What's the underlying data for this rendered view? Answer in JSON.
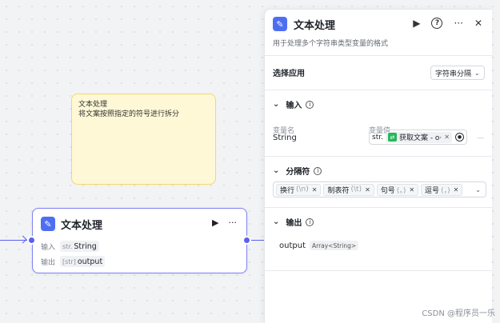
{
  "note": {
    "title": "文本处理",
    "body": "将文案按照指定的符号进行拆分"
  },
  "node": {
    "icon": "text-process-app-icon",
    "title": "文本处理",
    "run_icon": "▶",
    "more_icon": "···",
    "input_label": "输入",
    "input_type": "str.",
    "input_value": "String",
    "output_label": "输出",
    "output_type": "[str]",
    "output_value": "output"
  },
  "panel": {
    "title": "文本处理",
    "description": "用于处理多个字符串类型变量的格式",
    "run_icon": "▶",
    "help_icon": "?",
    "more_icon": "···",
    "close_icon": "✕",
    "apply_label": "选择应用",
    "apply_value": "字符串分隔",
    "input_section": "输入",
    "col_var_name": "变量名",
    "col_var_value": "变量值",
    "var_name": "String",
    "var_type": "str.",
    "var_ref": "获取文案 - o·",
    "separator_section": "分隔符",
    "separators": [
      {
        "label": "换行",
        "symbol": "(\\n)"
      },
      {
        "label": "制表符",
        "symbol": "(\\t)"
      },
      {
        "label": "句号",
        "symbol": "(。)"
      },
      {
        "label": "逗号",
        "symbol": "(，)"
      }
    ],
    "output_section": "输出",
    "output_name": "output",
    "output_type": "Array<String>"
  },
  "colors": {
    "accent": "#5a5ff0",
    "note_bg": "#fff8d6",
    "app_icon": "#4e6ef2",
    "green_icon": "#23b85b"
  },
  "watermark": "CSDN @程序员一乐"
}
